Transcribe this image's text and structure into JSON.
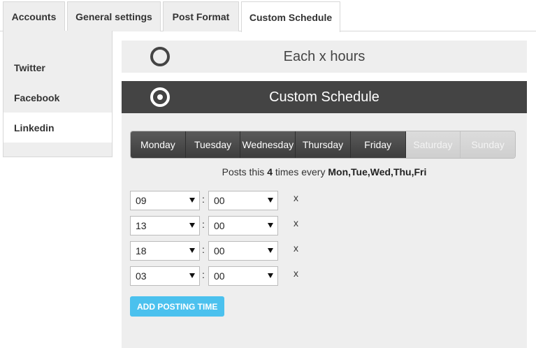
{
  "tabs": [
    {
      "label": "Accounts"
    },
    {
      "label": "General settings"
    },
    {
      "label": "Post Format"
    },
    {
      "label": "Custom Schedule",
      "active": true
    }
  ],
  "sidebar": {
    "items": [
      {
        "label": "Twitter"
      },
      {
        "label": "Facebook"
      },
      {
        "label": "Linkedin",
        "active": true
      }
    ]
  },
  "schedule_options": {
    "each_hours": {
      "label": "Each x hours",
      "selected": false
    },
    "custom": {
      "label": "Custom Schedule",
      "selected": true
    }
  },
  "days": [
    {
      "label": "Monday",
      "on": true
    },
    {
      "label": "Tuesday",
      "on": true
    },
    {
      "label": "Wednesday",
      "on": true
    },
    {
      "label": "Thursday",
      "on": true
    },
    {
      "label": "Friday",
      "on": true
    },
    {
      "label": "Saturday",
      "on": false
    },
    {
      "label": "Sunday",
      "on": false
    }
  ],
  "summary": {
    "prefix": "Posts this ",
    "count": "4",
    "middle": " times every ",
    "days": "Mon,Tue,Wed,Thu,Fri"
  },
  "times": [
    {
      "hour": "09",
      "minute": "00"
    },
    {
      "hour": "13",
      "minute": "00"
    },
    {
      "hour": "18",
      "minute": "00"
    },
    {
      "hour": "03",
      "minute": "00"
    }
  ],
  "time_separator": ":",
  "remove_label": "x",
  "add_button_label": "ADD POSTING TIME",
  "colors": {
    "accent": "#4bc1ee",
    "active_bar": "#444444",
    "panel_bg": "#eeeeee"
  }
}
